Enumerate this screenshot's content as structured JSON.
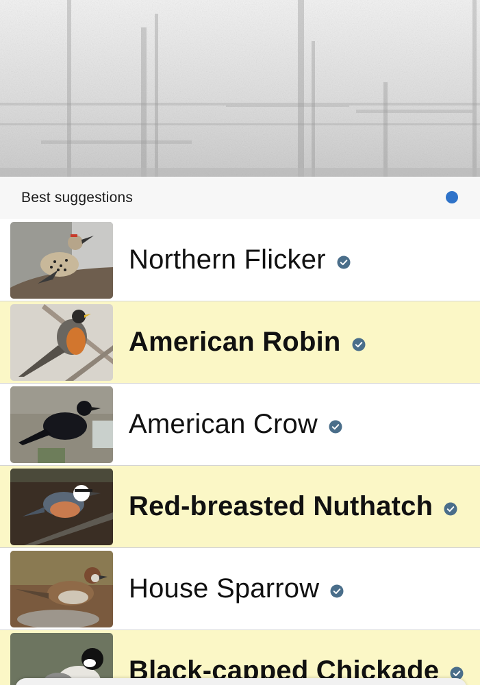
{
  "section": {
    "title": "Best suggestions",
    "indicator_color": "#2f73c9"
  },
  "colors": {
    "highlight_row": "#fbf7c6",
    "check_badge": "#4a6e8a"
  },
  "suggestions": [
    {
      "name": "Northern Flicker",
      "highlighted": false,
      "icon": "verified-check-icon"
    },
    {
      "name": "American Robin",
      "highlighted": true,
      "icon": "verified-check-icon"
    },
    {
      "name": "American Crow",
      "highlighted": false,
      "icon": "verified-check-icon"
    },
    {
      "name": "Red-breasted Nuthatch",
      "highlighted": true,
      "icon": "verified-check-icon"
    },
    {
      "name": "House Sparrow",
      "highlighted": false,
      "icon": "verified-check-icon"
    },
    {
      "name": "Black-capped Chickade",
      "highlighted": true,
      "icon": "verified-check-icon"
    }
  ]
}
